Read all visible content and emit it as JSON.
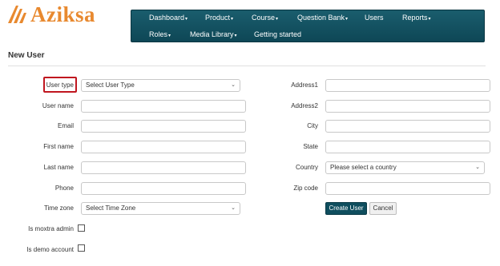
{
  "brand": {
    "name": "Aziksa"
  },
  "nav": {
    "items": [
      {
        "label": "Dashboard",
        "dropdown": true
      },
      {
        "label": "Product",
        "dropdown": true
      },
      {
        "label": "Course",
        "dropdown": true
      },
      {
        "label": "Question Bank",
        "dropdown": true
      },
      {
        "label": "Users",
        "dropdown": false
      },
      {
        "label": "Reports",
        "dropdown": true
      },
      {
        "label": "Roles",
        "dropdown": true
      },
      {
        "label": "Media Library",
        "dropdown": true
      },
      {
        "label": "Getting started",
        "dropdown": false
      }
    ]
  },
  "page": {
    "title": "New User"
  },
  "form": {
    "left": [
      {
        "label": "User type",
        "type": "select",
        "value": "Select User Type"
      },
      {
        "label": "User name",
        "type": "input",
        "value": ""
      },
      {
        "label": "Email",
        "type": "input",
        "value": ""
      },
      {
        "label": "First name",
        "type": "input",
        "value": ""
      },
      {
        "label": "Last name",
        "type": "input",
        "value": ""
      },
      {
        "label": "Phone",
        "type": "input",
        "value": ""
      },
      {
        "label": "Time zone",
        "type": "select",
        "value": "Select Time Zone"
      }
    ],
    "checkboxes": [
      {
        "label": "Is moxtra admin",
        "checked": false
      },
      {
        "label": "Is demo account",
        "checked": false
      }
    ],
    "right": [
      {
        "label": "Address1",
        "type": "input",
        "value": ""
      },
      {
        "label": "Address2",
        "type": "input",
        "value": ""
      },
      {
        "label": "City",
        "type": "input",
        "value": ""
      },
      {
        "label": "State",
        "type": "input",
        "value": ""
      },
      {
        "label": "Country",
        "type": "select",
        "value": "Please select a country"
      },
      {
        "label": "Zip code",
        "type": "input",
        "value": ""
      }
    ],
    "buttons": {
      "create": "Create User",
      "cancel": "Cancel"
    }
  },
  "colors": {
    "brand": "#e8892f",
    "nav_bg": "#0e4756",
    "primary_button": "#0f4e5e",
    "highlight_border": "#c0161f"
  }
}
